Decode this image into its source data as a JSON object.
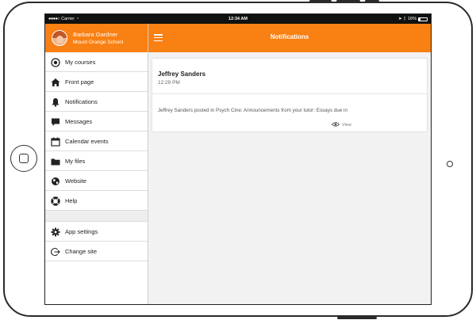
{
  "status_bar": {
    "carrier": "Carrier",
    "time": "12:34 AM",
    "battery": "16%",
    "battery_level": 0.16
  },
  "user": {
    "name": "Barbara Gardner",
    "school": "Mount Orange School"
  },
  "sidebar": {
    "items": [
      {
        "label": "My courses",
        "icon": "course-icon"
      },
      {
        "label": "Front page",
        "icon": "home-icon"
      },
      {
        "label": "Notifications",
        "icon": "bell-icon"
      },
      {
        "label": "Messages",
        "icon": "chat-icon"
      },
      {
        "label": "Calendar events",
        "icon": "calendar-icon"
      },
      {
        "label": "My files",
        "icon": "folder-icon"
      },
      {
        "label": "Website",
        "icon": "globe-icon"
      },
      {
        "label": "Help",
        "icon": "lifebuoy-icon"
      }
    ],
    "bottom_items": [
      {
        "label": "App settings",
        "icon": "gear-icon"
      },
      {
        "label": "Change site",
        "icon": "logout-icon"
      }
    ]
  },
  "header": {
    "title": "Notifications"
  },
  "notification": {
    "from": "Jeffrey Sanders",
    "time": "12:29 PM",
    "text": "Jeffrey Sanders posted in Psych Cine: Announcements from your tutor: Essays due in",
    "view_label": "View"
  },
  "colors": {
    "accent": "#f98012",
    "status_bar": "#111111",
    "content_bg": "#f2f2f2"
  }
}
